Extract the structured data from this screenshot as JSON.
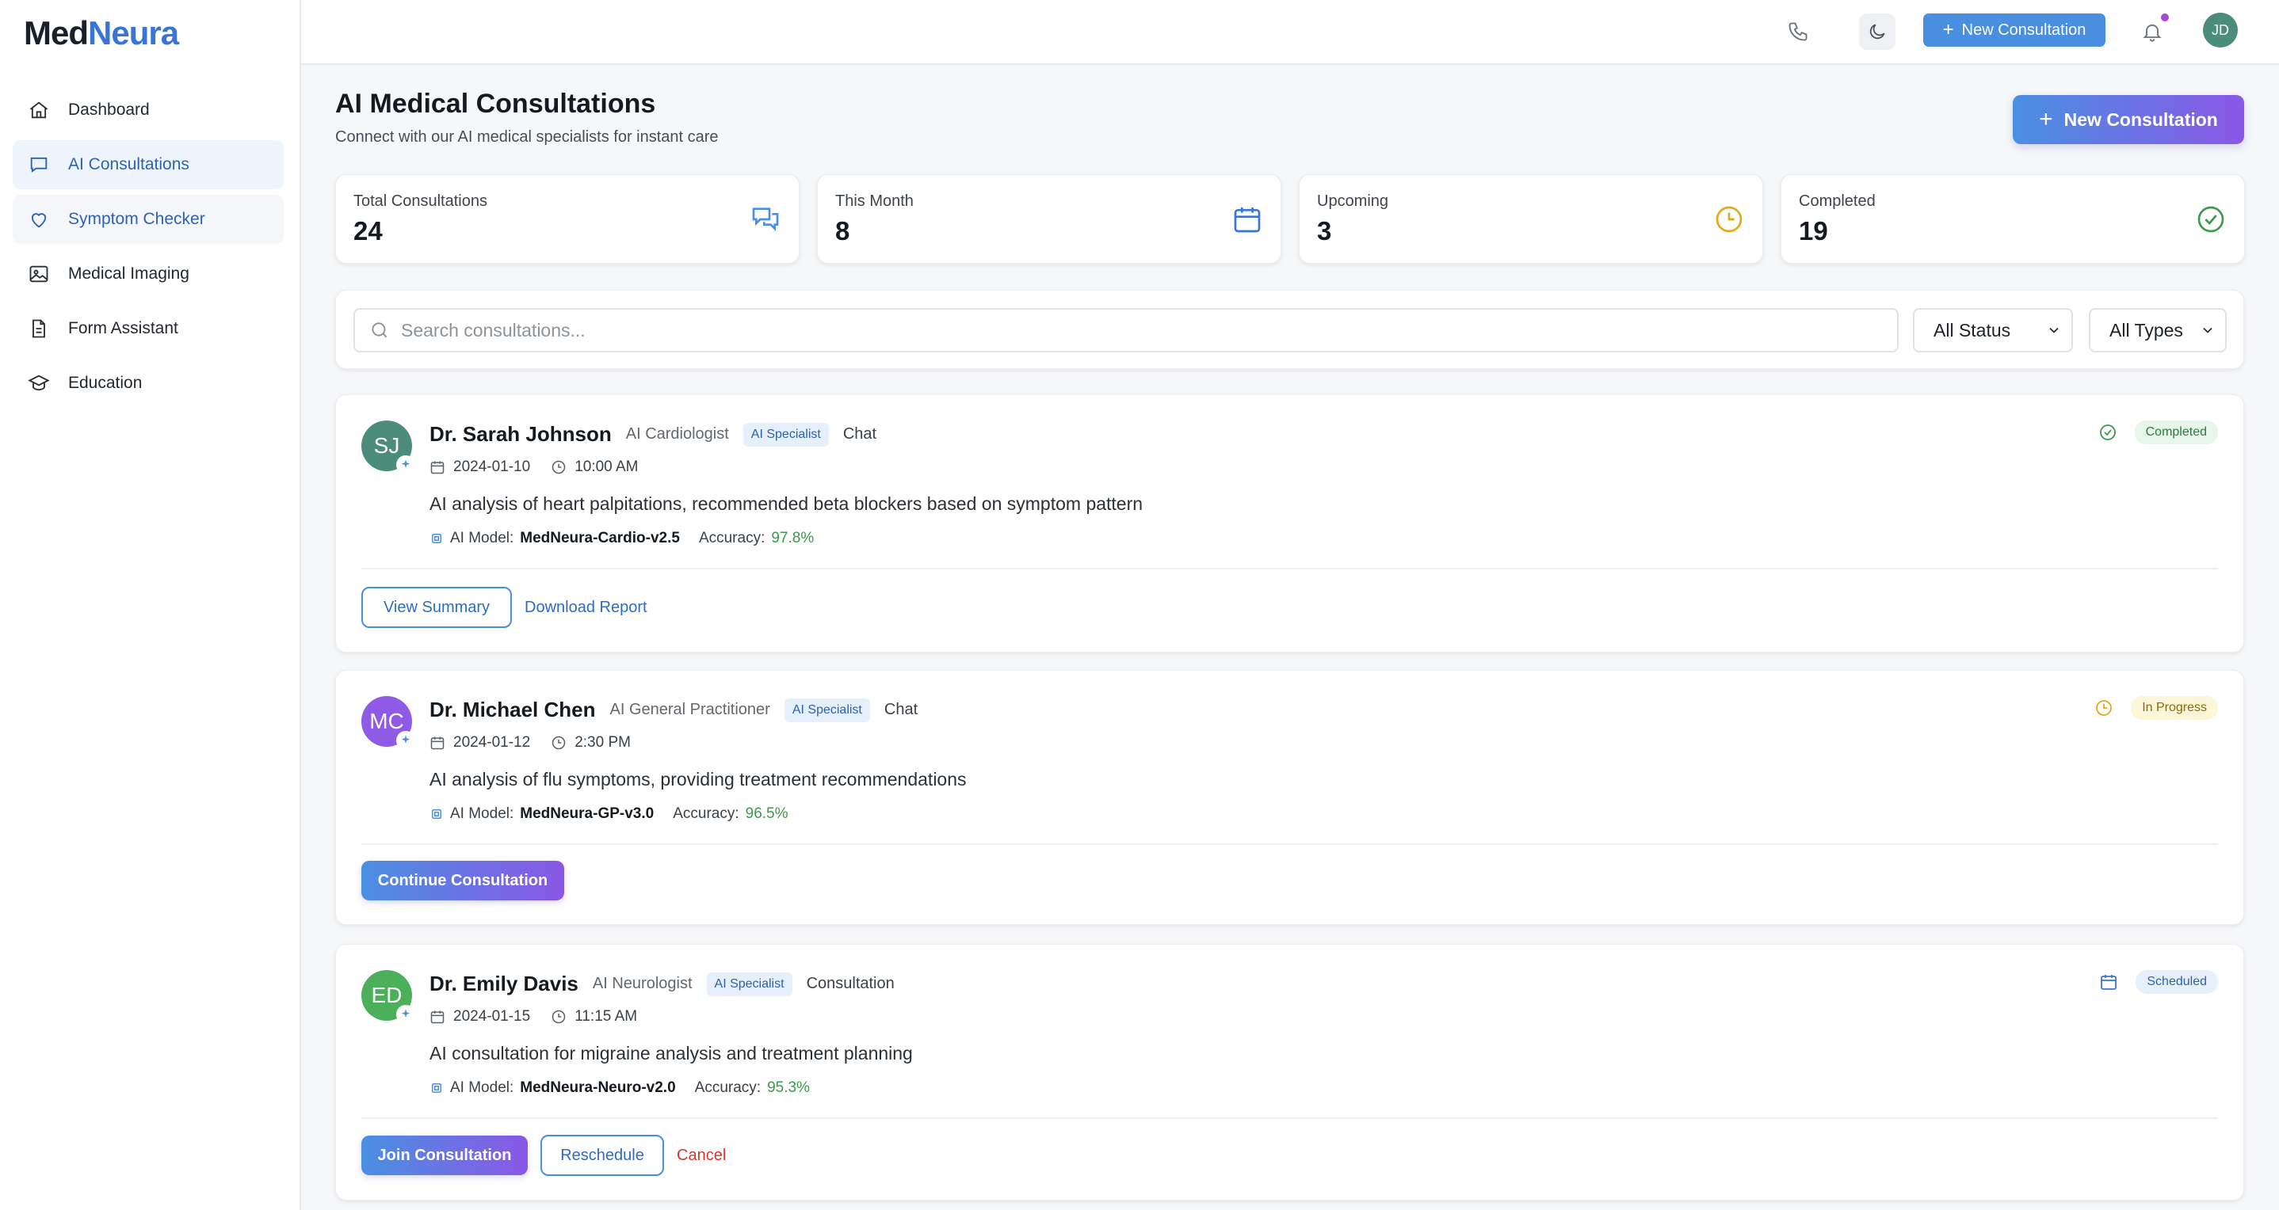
{
  "brand": {
    "part1": "Med",
    "part2": "Neura"
  },
  "sidebar": {
    "items": [
      {
        "label": "Dashboard",
        "icon": "home-icon"
      },
      {
        "label": "AI Consultations",
        "icon": "chat-icon"
      },
      {
        "label": "Symptom Checker",
        "icon": "heart-icon"
      },
      {
        "label": "Medical Imaging",
        "icon": "image-icon"
      },
      {
        "label": "Form Assistant",
        "icon": "document-icon"
      },
      {
        "label": "Education",
        "icon": "graduation-cap-icon"
      }
    ]
  },
  "header": {
    "new_consultation": "New Consultation",
    "avatar_initials": "JD"
  },
  "page": {
    "title": "AI Medical Consultations",
    "subtitle": "Connect with our AI medical specialists for instant care",
    "new_button": "New Consultation"
  },
  "stats": [
    {
      "label": "Total Consultations",
      "value": "24",
      "icon": "chat-bubbles-icon",
      "color": "#4a90e2"
    },
    {
      "label": "This Month",
      "value": "8",
      "icon": "calendar-icon",
      "color": "#3b74d8"
    },
    {
      "label": "Upcoming",
      "value": "3",
      "icon": "clock-icon",
      "color": "#e6a817"
    },
    {
      "label": "Completed",
      "value": "19",
      "icon": "check-circle-icon",
      "color": "#3c9a48"
    }
  ],
  "filters": {
    "search_placeholder": "Search consultations...",
    "status": "All Status",
    "types": "All Types"
  },
  "consultations": [
    {
      "initials": "SJ",
      "avatar_color": "#4c8c7a",
      "name": "Dr. Sarah Johnson",
      "role": "AI Cardiologist",
      "badge": "AI Specialist",
      "type": "Chat",
      "date": "2024-01-10",
      "time": "10:00 AM",
      "description": "AI analysis of heart palpitations, recommended beta blockers based on symptom pattern",
      "model_label": "AI Model:",
      "model": "MedNeura-Cardio-v2.5",
      "accuracy_label": "Accuracy:",
      "accuracy": "97.8%",
      "status": "Completed",
      "actions": [
        "View Summary",
        "Download Report"
      ]
    },
    {
      "initials": "MC",
      "avatar_color": "#8f5ae6",
      "name": "Dr. Michael Chen",
      "role": "AI General Practitioner",
      "badge": "AI Specialist",
      "type": "Chat",
      "date": "2024-01-12",
      "time": "2:30 PM",
      "description": "AI analysis of flu symptoms, providing treatment recommendations",
      "model_label": "AI Model:",
      "model": "MedNeura-GP-v3.0",
      "accuracy_label": "Accuracy:",
      "accuracy": "96.5%",
      "status": "In Progress",
      "actions": [
        "Continue Consultation"
      ]
    },
    {
      "initials": "ED",
      "avatar_color": "#4cb05a",
      "name": "Dr. Emily Davis",
      "role": "AI Neurologist",
      "badge": "AI Specialist",
      "type": "Consultation",
      "date": "2024-01-15",
      "time": "11:15 AM",
      "description": "AI consultation for migraine analysis and treatment planning",
      "model_label": "AI Model:",
      "model": "MedNeura-Neuro-v2.0",
      "accuracy_label": "Accuracy:",
      "accuracy": "95.3%",
      "status": "Scheduled",
      "actions": [
        "Join Consultation",
        "Reschedule",
        "Cancel"
      ]
    }
  ]
}
